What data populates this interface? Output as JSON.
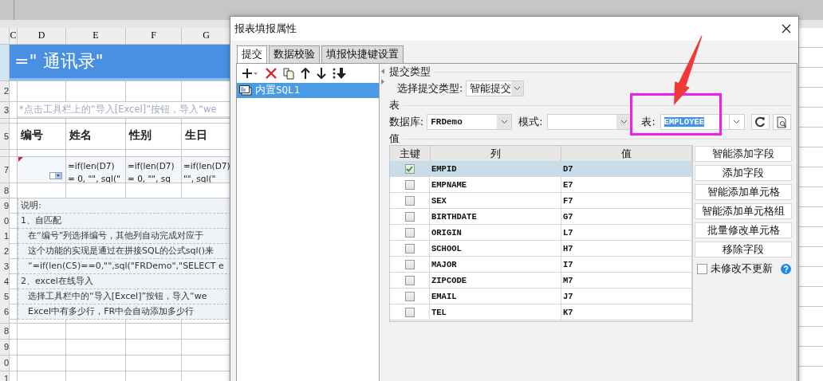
{
  "sheet": {
    "columns": [
      "C",
      "D",
      "E",
      "F",
      "G"
    ],
    "title": "=\"  通讯录\"",
    "hint": "*点击工具栏上的“导入[Excel]”按钮，导入“we",
    "fields": [
      "编号",
      "姓名",
      "性别",
      "生日"
    ],
    "formulas": [
      {
        "line1": "=if(len(D7)",
        "line2": "= 0, \"\", sql(\""
      },
      {
        "line1": "=if(len(D7)",
        "line2": "= 0, \"\", sq"
      },
      {
        "line1": "=if(len(D7)",
        "line2": "\"\", sql(\""
      }
    ],
    "notes": [
      {
        "text": "说明:",
        "indent": false
      },
      {
        "text": "1、自匹配",
        "indent": false
      },
      {
        "text": "在“编号”列选择编号，其他列自动完成对应于",
        "indent": true
      },
      {
        "text": "这个功能的实现是通过在拼接SQL的公式sql()来",
        "indent": true
      },
      {
        "text": "“=if(len(C5)==0,\"\",sql(\"FRDemo\",\"SELECT e",
        "indent": true
      },
      {
        "text": "2、excel在线导入",
        "indent": false
      },
      {
        "text": "选择工具栏中的“导入[Excel]”按钮，导入“we",
        "indent": true
      },
      {
        "text": "Excel中有多少行，FR中会自动添加多少行",
        "indent": true
      }
    ],
    "row_labels": [
      "2",
      "3",
      "5",
      "7",
      "8",
      "9",
      "0",
      "1",
      "2",
      "3",
      "4",
      "5",
      "6",
      "8",
      "9",
      "0",
      "1"
    ]
  },
  "dialog": {
    "title": "报表填报属性",
    "tabs": [
      {
        "label": "提交",
        "selected": true
      },
      {
        "label": "数据校验",
        "selected": false
      },
      {
        "label": "填报快捷键设置",
        "selected": false
      }
    ],
    "list": [
      {
        "label": "内置SQL1",
        "selected": true
      }
    ],
    "submit_group": "提交类型",
    "submit_type_label": "选择提交类型:",
    "submit_type": "智能提交",
    "table_group": "表",
    "database_label": "数据库:",
    "database": "FRDemo",
    "schema_label": "模式:",
    "table_label": "表:",
    "table": "EMPLOYEE",
    "table_text_selected": true,
    "values_group": "值",
    "columns": [
      "主键",
      "列",
      "值"
    ],
    "rows": [
      {
        "key": true,
        "column": "EMPID",
        "value": "D7",
        "selected": true
      },
      {
        "key": false,
        "column": "EMPNAME",
        "value": "E7",
        "selected": false
      },
      {
        "key": false,
        "column": "SEX",
        "value": "F7",
        "selected": false
      },
      {
        "key": false,
        "column": "BIRTHDATE",
        "value": "G7",
        "selected": false
      },
      {
        "key": false,
        "column": "ORIGIN",
        "value": "L7",
        "selected": false
      },
      {
        "key": false,
        "column": "SCHOOL",
        "value": "H7",
        "selected": false
      },
      {
        "key": false,
        "column": "MAJOR",
        "value": "I7",
        "selected": false
      },
      {
        "key": false,
        "column": "ZIPCODE",
        "value": "M7",
        "selected": false
      },
      {
        "key": false,
        "column": "EMAIL",
        "value": "J7",
        "selected": false
      },
      {
        "key": false,
        "column": "TEL",
        "value": "K7",
        "selected": false
      }
    ],
    "buttons": [
      "智能添加字段",
      "添加字段",
      "智能添加单元格",
      "智能添加单元格组",
      "批量修改单元格",
      "移除字段"
    ],
    "no_update": {
      "label": "未修改不更新",
      "checked": false
    }
  }
}
